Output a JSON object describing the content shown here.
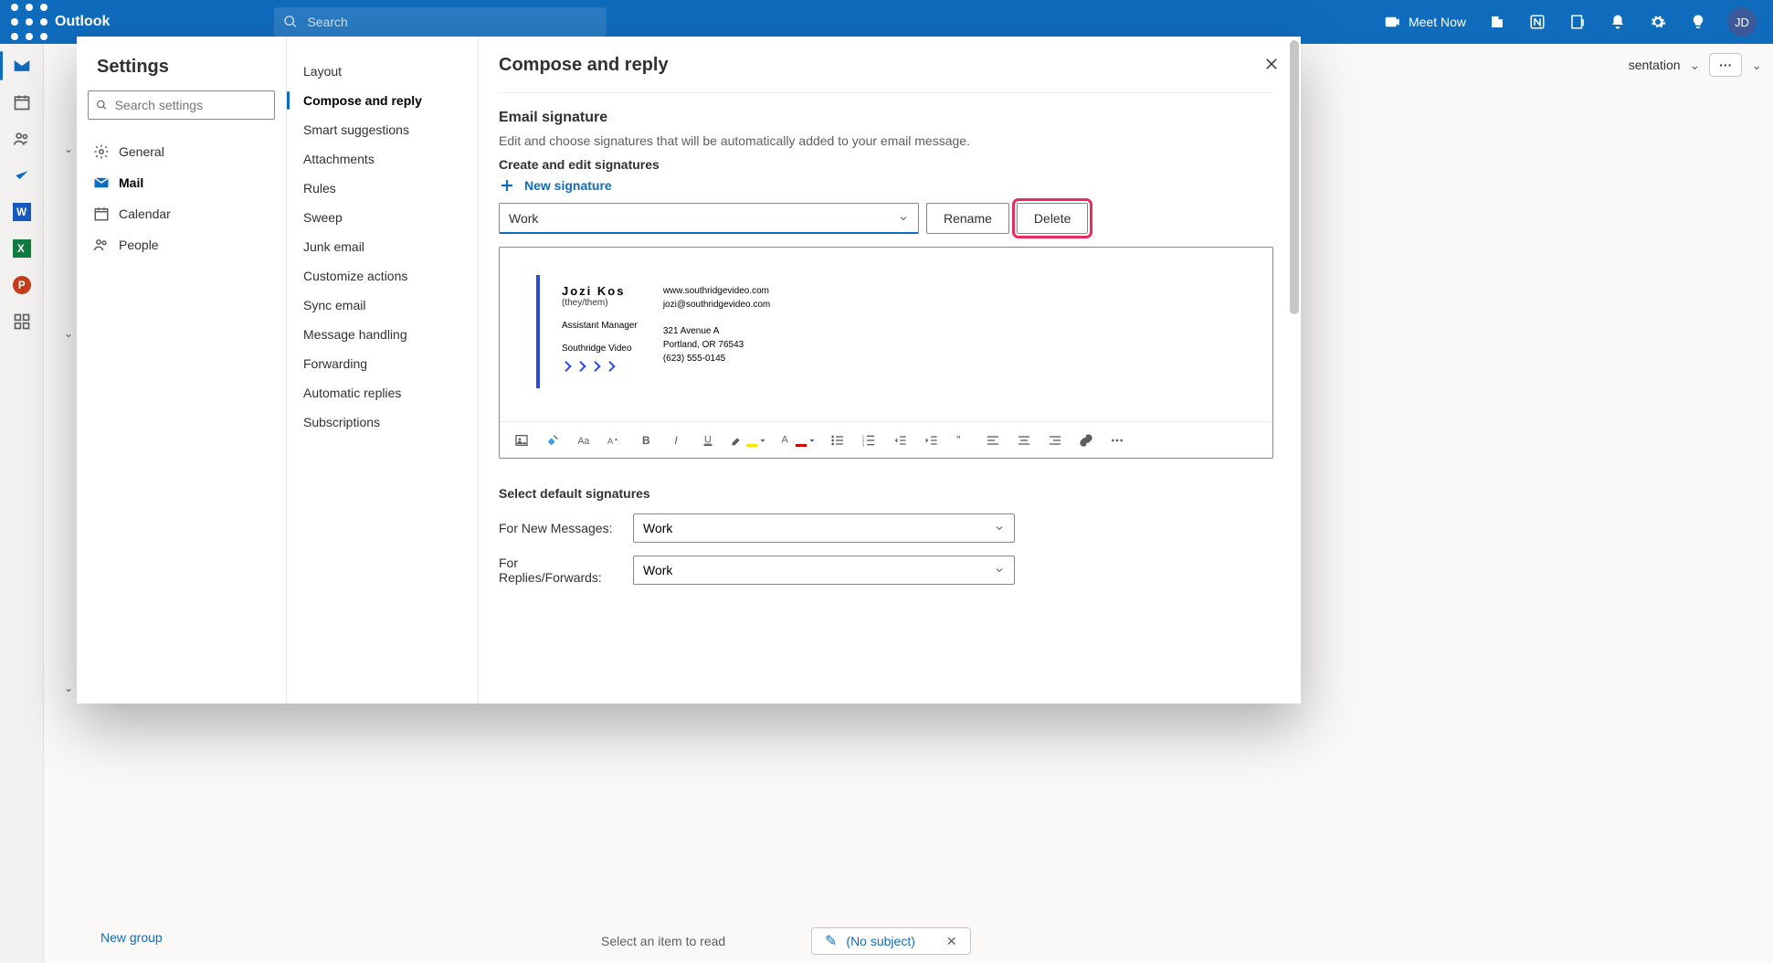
{
  "header": {
    "product": "Outlook",
    "search_placeholder": "Search",
    "meet_now": "Meet Now",
    "avatar_initials": "JD"
  },
  "backdrop": {
    "new_group": "New group",
    "ribbonfrag_text": "sentation",
    "more_label": "···",
    "reading_pane": "Select an item to read",
    "draft_subject": "(No subject)"
  },
  "settings": {
    "title": "Settings",
    "search_placeholder": "Search settings",
    "categories": {
      "general": "General",
      "mail": "Mail",
      "calendar": "Calendar",
      "people": "People"
    },
    "mail_sections": {
      "layout": "Layout",
      "compose": "Compose and reply",
      "smart": "Smart suggestions",
      "attachments": "Attachments",
      "rules": "Rules",
      "sweep": "Sweep",
      "junk": "Junk email",
      "customize": "Customize actions",
      "sync": "Sync email",
      "message_handling": "Message handling",
      "forwarding": "Forwarding",
      "automatic": "Automatic replies",
      "subscriptions": "Subscriptions"
    }
  },
  "compose": {
    "title": "Compose and reply",
    "sig_heading": "Email signature",
    "sig_desc": "Edit and choose signatures that will be automatically added to your email message.",
    "create_edit": "Create and edit signatures",
    "new_signature": "New signature",
    "signature_name": "Work",
    "rename": "Rename",
    "delete": "Delete",
    "default_heading": "Select default signatures",
    "for_new": "For New Messages:",
    "for_reply": "For Replies/Forwards:",
    "default_new_value": "Work",
    "default_reply_value": "Work"
  },
  "signature_content": {
    "name": "Jozi Kos",
    "pronouns": "(they/them)",
    "role": "Assistant Manager",
    "company": "Southridge Video",
    "website": "www.southridgevideo.com",
    "email": "jozi@southridgevideo.com",
    "addr1": "321 Avenue A",
    "addr2": "Portland, OR 76543",
    "phone": "(623) 555-0145"
  }
}
